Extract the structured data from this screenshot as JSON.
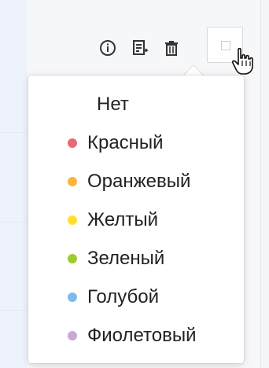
{
  "toolbar": {
    "info_icon": "info-icon",
    "document_icon": "document-export-icon",
    "trash_icon": "trash-icon",
    "color_icon": "color-swatch-icon"
  },
  "color_menu": {
    "items": [
      {
        "label": "Нет",
        "color": null
      },
      {
        "label": "Красный",
        "color": "#e66a74"
      },
      {
        "label": "Оранжевый",
        "color": "#ffb437"
      },
      {
        "label": "Желтый",
        "color": "#ffe02c"
      },
      {
        "label": "Зеленый",
        "color": "#9ccc2f"
      },
      {
        "label": "Голубой",
        "color": "#7fb9ee"
      },
      {
        "label": "Фиолетовый",
        "color": "#c9a8d8"
      }
    ]
  }
}
